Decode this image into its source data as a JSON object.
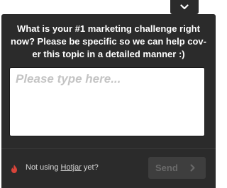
{
  "survey": {
    "question": "What is your #1 marketing challenge right now? Please be specific so we can help cov-er this topic in a detailed manner :)",
    "answer_placeholder": "Please type here...",
    "answer_value": ""
  },
  "footer": {
    "prefix": "Not using ",
    "link_label": "Hotjar",
    "suffix": " yet?",
    "send_label": "Send"
  },
  "colors": {
    "panel": "#2b2b2b",
    "logo": "#d9443a"
  },
  "icons": {
    "collapse": "chevron-down-icon",
    "logo": "hotjar-flame-icon",
    "send_arrow": "chevron-right-icon"
  }
}
